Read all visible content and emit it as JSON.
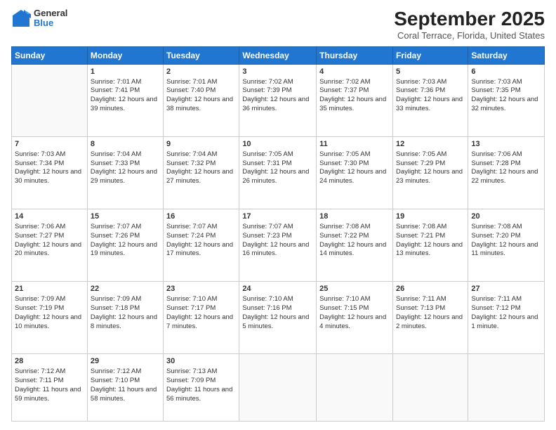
{
  "logo": {
    "general": "General",
    "blue": "Blue"
  },
  "header": {
    "month": "September 2025",
    "location": "Coral Terrace, Florida, United States"
  },
  "days": [
    "Sunday",
    "Monday",
    "Tuesday",
    "Wednesday",
    "Thursday",
    "Friday",
    "Saturday"
  ],
  "weeks": [
    [
      {
        "day": "",
        "content": ""
      },
      {
        "day": "1",
        "sunrise": "Sunrise: 7:01 AM",
        "sunset": "Sunset: 7:41 PM",
        "daylight": "Daylight: 12 hours and 39 minutes."
      },
      {
        "day": "2",
        "sunrise": "Sunrise: 7:01 AM",
        "sunset": "Sunset: 7:40 PM",
        "daylight": "Daylight: 12 hours and 38 minutes."
      },
      {
        "day": "3",
        "sunrise": "Sunrise: 7:02 AM",
        "sunset": "Sunset: 7:39 PM",
        "daylight": "Daylight: 12 hours and 36 minutes."
      },
      {
        "day": "4",
        "sunrise": "Sunrise: 7:02 AM",
        "sunset": "Sunset: 7:37 PM",
        "daylight": "Daylight: 12 hours and 35 minutes."
      },
      {
        "day": "5",
        "sunrise": "Sunrise: 7:03 AM",
        "sunset": "Sunset: 7:36 PM",
        "daylight": "Daylight: 12 hours and 33 minutes."
      },
      {
        "day": "6",
        "sunrise": "Sunrise: 7:03 AM",
        "sunset": "Sunset: 7:35 PM",
        "daylight": "Daylight: 12 hours and 32 minutes."
      }
    ],
    [
      {
        "day": "7",
        "sunrise": "Sunrise: 7:03 AM",
        "sunset": "Sunset: 7:34 PM",
        "daylight": "Daylight: 12 hours and 30 minutes."
      },
      {
        "day": "8",
        "sunrise": "Sunrise: 7:04 AM",
        "sunset": "Sunset: 7:33 PM",
        "daylight": "Daylight: 12 hours and 29 minutes."
      },
      {
        "day": "9",
        "sunrise": "Sunrise: 7:04 AM",
        "sunset": "Sunset: 7:32 PM",
        "daylight": "Daylight: 12 hours and 27 minutes."
      },
      {
        "day": "10",
        "sunrise": "Sunrise: 7:05 AM",
        "sunset": "Sunset: 7:31 PM",
        "daylight": "Daylight: 12 hours and 26 minutes."
      },
      {
        "day": "11",
        "sunrise": "Sunrise: 7:05 AM",
        "sunset": "Sunset: 7:30 PM",
        "daylight": "Daylight: 12 hours and 24 minutes."
      },
      {
        "day": "12",
        "sunrise": "Sunrise: 7:05 AM",
        "sunset": "Sunset: 7:29 PM",
        "daylight": "Daylight: 12 hours and 23 minutes."
      },
      {
        "day": "13",
        "sunrise": "Sunrise: 7:06 AM",
        "sunset": "Sunset: 7:28 PM",
        "daylight": "Daylight: 12 hours and 22 minutes."
      }
    ],
    [
      {
        "day": "14",
        "sunrise": "Sunrise: 7:06 AM",
        "sunset": "Sunset: 7:27 PM",
        "daylight": "Daylight: 12 hours and 20 minutes."
      },
      {
        "day": "15",
        "sunrise": "Sunrise: 7:07 AM",
        "sunset": "Sunset: 7:26 PM",
        "daylight": "Daylight: 12 hours and 19 minutes."
      },
      {
        "day": "16",
        "sunrise": "Sunrise: 7:07 AM",
        "sunset": "Sunset: 7:24 PM",
        "daylight": "Daylight: 12 hours and 17 minutes."
      },
      {
        "day": "17",
        "sunrise": "Sunrise: 7:07 AM",
        "sunset": "Sunset: 7:23 PM",
        "daylight": "Daylight: 12 hours and 16 minutes."
      },
      {
        "day": "18",
        "sunrise": "Sunrise: 7:08 AM",
        "sunset": "Sunset: 7:22 PM",
        "daylight": "Daylight: 12 hours and 14 minutes."
      },
      {
        "day": "19",
        "sunrise": "Sunrise: 7:08 AM",
        "sunset": "Sunset: 7:21 PM",
        "daylight": "Daylight: 12 hours and 13 minutes."
      },
      {
        "day": "20",
        "sunrise": "Sunrise: 7:08 AM",
        "sunset": "Sunset: 7:20 PM",
        "daylight": "Daylight: 12 hours and 11 minutes."
      }
    ],
    [
      {
        "day": "21",
        "sunrise": "Sunrise: 7:09 AM",
        "sunset": "Sunset: 7:19 PM",
        "daylight": "Daylight: 12 hours and 10 minutes."
      },
      {
        "day": "22",
        "sunrise": "Sunrise: 7:09 AM",
        "sunset": "Sunset: 7:18 PM",
        "daylight": "Daylight: 12 hours and 8 minutes."
      },
      {
        "day": "23",
        "sunrise": "Sunrise: 7:10 AM",
        "sunset": "Sunset: 7:17 PM",
        "daylight": "Daylight: 12 hours and 7 minutes."
      },
      {
        "day": "24",
        "sunrise": "Sunrise: 7:10 AM",
        "sunset": "Sunset: 7:16 PM",
        "daylight": "Daylight: 12 hours and 5 minutes."
      },
      {
        "day": "25",
        "sunrise": "Sunrise: 7:10 AM",
        "sunset": "Sunset: 7:15 PM",
        "daylight": "Daylight: 12 hours and 4 minutes."
      },
      {
        "day": "26",
        "sunrise": "Sunrise: 7:11 AM",
        "sunset": "Sunset: 7:13 PM",
        "daylight": "Daylight: 12 hours and 2 minutes."
      },
      {
        "day": "27",
        "sunrise": "Sunrise: 7:11 AM",
        "sunset": "Sunset: 7:12 PM",
        "daylight": "Daylight: 12 hours and 1 minute."
      }
    ],
    [
      {
        "day": "28",
        "sunrise": "Sunrise: 7:12 AM",
        "sunset": "Sunset: 7:11 PM",
        "daylight": "Daylight: 11 hours and 59 minutes."
      },
      {
        "day": "29",
        "sunrise": "Sunrise: 7:12 AM",
        "sunset": "Sunset: 7:10 PM",
        "daylight": "Daylight: 11 hours and 58 minutes."
      },
      {
        "day": "30",
        "sunrise": "Sunrise: 7:13 AM",
        "sunset": "Sunset: 7:09 PM",
        "daylight": "Daylight: 11 hours and 56 minutes."
      },
      {
        "day": "",
        "content": ""
      },
      {
        "day": "",
        "content": ""
      },
      {
        "day": "",
        "content": ""
      },
      {
        "day": "",
        "content": ""
      }
    ]
  ]
}
